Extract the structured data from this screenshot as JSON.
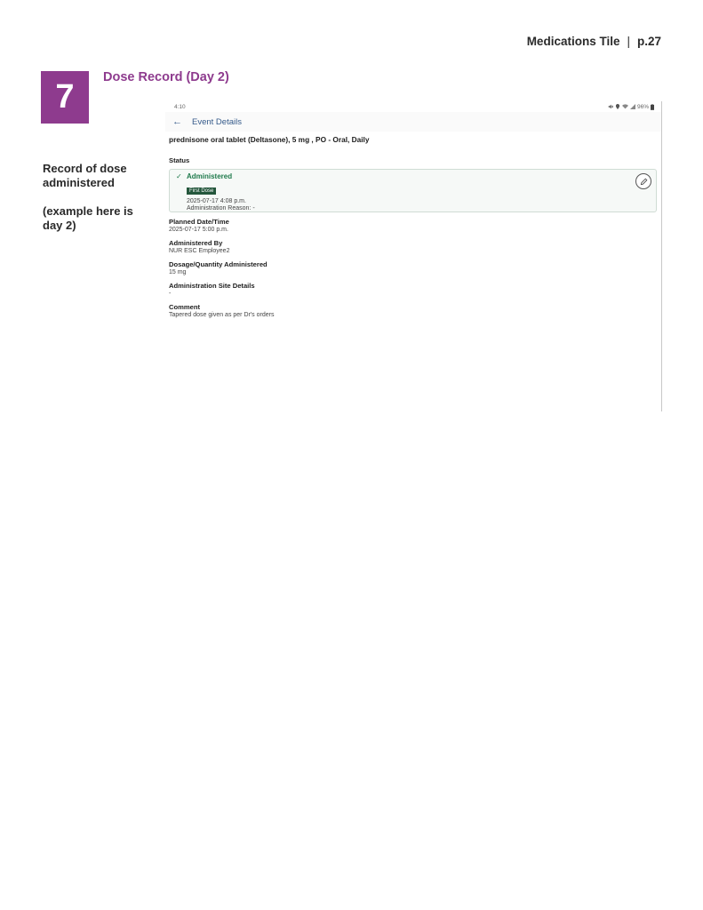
{
  "page": {
    "tile": "Medications Tile",
    "separator": "|",
    "page_number": "p.27"
  },
  "step": {
    "number": "7",
    "title": "Dose Record (Day 2)"
  },
  "side_note": {
    "line1": "Record of dose administered",
    "line2": "(example here is day 2)"
  },
  "device": {
    "status_bar": {
      "time": "4:10",
      "battery": "96%"
    },
    "app_bar": {
      "title": "Event Details"
    },
    "medication": "prednisone oral tablet (Deltasone), 5 mg , PO - Oral, Daily",
    "status": {
      "label": "Status",
      "value": "Administered",
      "badge": "First Dose",
      "datetime": "2025-07-17 4:08 p.m.",
      "reason": "Administration Reason: -"
    },
    "fields": [
      {
        "label": "Planned Date/Time",
        "value": "2025-07-17 5:00 p.m."
      },
      {
        "label": "Administered By",
        "value": "NUR ESC Employee2"
      },
      {
        "label": "Dosage/Quantity Administered",
        "value": "15 mg"
      },
      {
        "label": "Administration Site Details",
        "value": "-"
      },
      {
        "label": "Comment",
        "value": "Tapered dose given as per Dr's orders"
      }
    ]
  },
  "icons": {
    "back": "arrow-left-icon",
    "check": "check-icon",
    "edit": "pencil-icon",
    "status": [
      "mute-icon",
      "location-icon",
      "wifi-icon",
      "signal-icon",
      "battery-icon"
    ]
  },
  "colors": {
    "accent": "#8e3b8e",
    "success": "#1f7a4c",
    "badge": "#24573c",
    "link": "#355a8a"
  }
}
